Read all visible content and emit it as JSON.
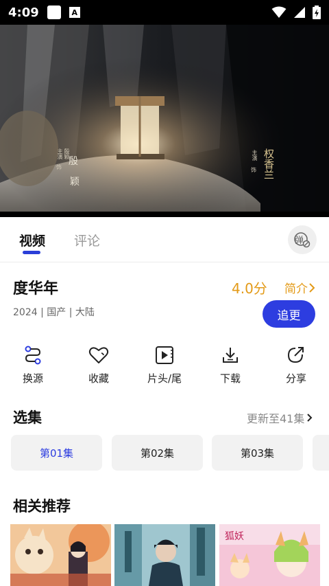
{
  "status_bar": {
    "time": "4:09",
    "badge": "A"
  },
  "video": {
    "subtitles": [
      "殷",
      "颖",
      "权香兰"
    ],
    "small_tags": [
      "主演",
      "饰",
      "殷颖",
      "主演",
      "饰"
    ]
  },
  "tabs": [
    {
      "label": "视频",
      "active": true
    },
    {
      "label": "评论",
      "active": false
    }
  ],
  "danmu": {
    "label": "弹"
  },
  "show": {
    "title": "度华年",
    "score": "4.0分",
    "intro_label": "简介",
    "meta": "2024 | 国产 | 大陆",
    "follow_label": "追更"
  },
  "actions": [
    {
      "label": "换源",
      "icon": "switch-source-icon"
    },
    {
      "label": "收藏",
      "icon": "heart-icon"
    },
    {
      "label": "片头/尾",
      "icon": "skip-intro-icon"
    },
    {
      "label": "下载",
      "icon": "download-icon"
    },
    {
      "label": "分享",
      "icon": "share-icon"
    }
  ],
  "episodes": {
    "title": "选集",
    "update_text": "更新至41集",
    "items": [
      "第01集",
      "第02集",
      "第03集"
    ],
    "active_index": 0
  },
  "recommend": {
    "title": "相关推荐"
  },
  "colors": {
    "accent": "#2d3de0",
    "gold": "#e39a17"
  }
}
